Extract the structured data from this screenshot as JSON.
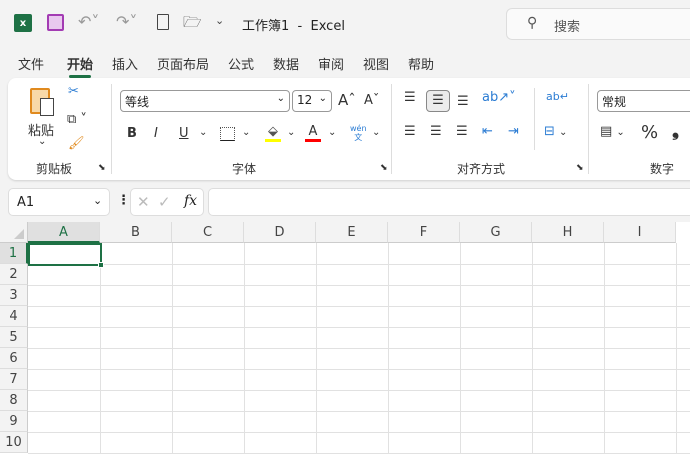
{
  "titlebar": {
    "title": "工作簿1  -  Excel",
    "search_placeholder": "搜索"
  },
  "tabs": [
    "文件",
    "开始",
    "插入",
    "页面布局",
    "公式",
    "数据",
    "审阅",
    "视图",
    "帮助"
  ],
  "active_tab": "开始",
  "ribbon": {
    "clipboard": {
      "paste": "粘贴",
      "group": "剪贴板"
    },
    "font": {
      "name": "等线",
      "size": "12",
      "bold": "B",
      "italic": "I",
      "underline": "U",
      "group": "字体",
      "font_color": "A",
      "fill_color_hex": "#ffff00",
      "font_color_hex": "#ff0000"
    },
    "alignment": {
      "group": "对齐方式"
    },
    "number": {
      "format": "常规",
      "percent": "%",
      "comma": "❟",
      "group": "数字"
    }
  },
  "formula_bar": {
    "name_box": "A1",
    "fx": "fx",
    "value": ""
  },
  "columns": [
    "A",
    "B",
    "C",
    "D",
    "E",
    "F",
    "G",
    "H",
    "I"
  ],
  "rows": [
    "1",
    "2",
    "3",
    "4",
    "5",
    "6",
    "7",
    "8",
    "9",
    "10"
  ],
  "selected_cell": "A1",
  "accent": "#1e7145"
}
